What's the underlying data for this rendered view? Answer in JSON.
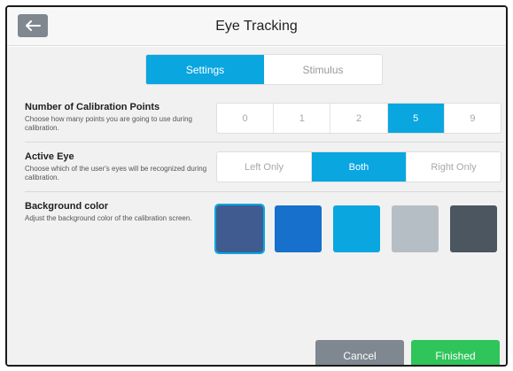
{
  "header": {
    "title": "Eye Tracking",
    "back_icon": "arrow-left-icon"
  },
  "tabs": [
    {
      "label": "Settings",
      "active": true
    },
    {
      "label": "Stimulus",
      "active": false
    }
  ],
  "calibration_points": {
    "title": "Number of Calibration Points",
    "description": "Choose how many points you are going to use during calibration.",
    "options": [
      "0",
      "1",
      "2",
      "5",
      "9"
    ],
    "selected": "5"
  },
  "active_eye": {
    "title": "Active Eye",
    "description": "Choose which of the user's eyes will be recognized during calibration.",
    "options": [
      "Left Only",
      "Both",
      "Right Only"
    ],
    "selected": "Both"
  },
  "background_color": {
    "title": "Background color",
    "description": "Adjust the background color of the calibration screen.",
    "swatches": [
      "#3f5b8f",
      "#1670cc",
      "#0aa6e0",
      "#b6bec5",
      "#4b5660"
    ],
    "selected_index": 0
  },
  "footer": {
    "cancel_label": "Cancel",
    "finish_label": "Finished"
  },
  "colors": {
    "accent": "#0aa6e0",
    "success": "#2fc55a",
    "neutral": "#7f8790"
  }
}
